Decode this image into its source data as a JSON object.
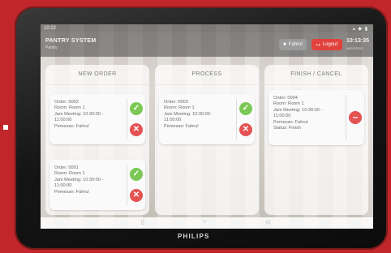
{
  "statusbar": {
    "time": "10:22",
    "icons": "▴ ◆ ▮"
  },
  "header": {
    "app_title": "PANTRY SYSTEM",
    "app_subtitle": "Pantry",
    "user_label": "Fahrul",
    "logout_label": "Logout",
    "clock": "10:13:35",
    "date": "06/07/2023"
  },
  "columns": [
    {
      "title": "NEW ORDER",
      "cards": [
        {
          "order": "Order: 0002",
          "room": "Room: Room 1",
          "meeting": "Jam Meeting: 10:30:00 -\n11:00:00",
          "by": "Pemesan: Fahrul"
        },
        {
          "order": "Order: 0001",
          "room": "Room: Room 1",
          "meeting": "Jam Meeting: 10:30:00 -\n11:00:00",
          "by": "Pemesan: Fahrul"
        }
      ]
    },
    {
      "title": "PROCESS",
      "cards": [
        {
          "order": "Order: 0003",
          "room": "Room: Room 1",
          "meeting": "Jam Meeting: 10:30:00 -\n11:00:00",
          "by": "Pemesan: Fahrul"
        }
      ]
    },
    {
      "title": "FINISH / CANCEL",
      "cards": [
        {
          "order": "Order: 0004",
          "room": "Room: Room 1",
          "meeting": "Jam Meeting: 10:30:00 -\n11:00:00",
          "by": "Pemesan: Fahrul",
          "status": "Status: Finish"
        }
      ]
    }
  ],
  "icons": {
    "approve": "check-icon",
    "reject": "close-icon",
    "remove": "minus-icon"
  },
  "colors": {
    "accent": "#e2423d",
    "approve": "#7cc856",
    "reject": "#e45252",
    "frame": "#c0262a"
  },
  "navbar": {
    "back": "◁",
    "home": "○",
    "recent": "▯"
  },
  "device": {
    "brand": "PHILIPS"
  }
}
